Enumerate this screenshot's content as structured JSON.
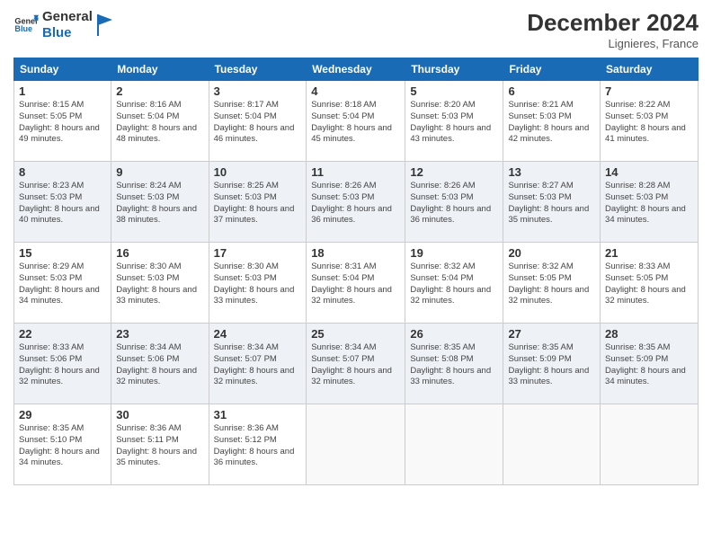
{
  "logo": {
    "line1": "General",
    "line2": "Blue"
  },
  "title": "December 2024",
  "location": "Lignieres, France",
  "days_of_week": [
    "Sunday",
    "Monday",
    "Tuesday",
    "Wednesday",
    "Thursday",
    "Friday",
    "Saturday"
  ],
  "weeks": [
    [
      {
        "day": "1",
        "sunrise": "8:15 AM",
        "sunset": "5:05 PM",
        "daylight": "8 hours and 49 minutes."
      },
      {
        "day": "2",
        "sunrise": "8:16 AM",
        "sunset": "5:04 PM",
        "daylight": "8 hours and 48 minutes."
      },
      {
        "day": "3",
        "sunrise": "8:17 AM",
        "sunset": "5:04 PM",
        "daylight": "8 hours and 46 minutes."
      },
      {
        "day": "4",
        "sunrise": "8:18 AM",
        "sunset": "5:04 PM",
        "daylight": "8 hours and 45 minutes."
      },
      {
        "day": "5",
        "sunrise": "8:20 AM",
        "sunset": "5:03 PM",
        "daylight": "8 hours and 43 minutes."
      },
      {
        "day": "6",
        "sunrise": "8:21 AM",
        "sunset": "5:03 PM",
        "daylight": "8 hours and 42 minutes."
      },
      {
        "day": "7",
        "sunrise": "8:22 AM",
        "sunset": "5:03 PM",
        "daylight": "8 hours and 41 minutes."
      }
    ],
    [
      {
        "day": "8",
        "sunrise": "8:23 AM",
        "sunset": "5:03 PM",
        "daylight": "8 hours and 40 minutes."
      },
      {
        "day": "9",
        "sunrise": "8:24 AM",
        "sunset": "5:03 PM",
        "daylight": "8 hours and 38 minutes."
      },
      {
        "day": "10",
        "sunrise": "8:25 AM",
        "sunset": "5:03 PM",
        "daylight": "8 hours and 37 minutes."
      },
      {
        "day": "11",
        "sunrise": "8:26 AM",
        "sunset": "5:03 PM",
        "daylight": "8 hours and 36 minutes."
      },
      {
        "day": "12",
        "sunrise": "8:26 AM",
        "sunset": "5:03 PM",
        "daylight": "8 hours and 36 minutes."
      },
      {
        "day": "13",
        "sunrise": "8:27 AM",
        "sunset": "5:03 PM",
        "daylight": "8 hours and 35 minutes."
      },
      {
        "day": "14",
        "sunrise": "8:28 AM",
        "sunset": "5:03 PM",
        "daylight": "8 hours and 34 minutes."
      }
    ],
    [
      {
        "day": "15",
        "sunrise": "8:29 AM",
        "sunset": "5:03 PM",
        "daylight": "8 hours and 34 minutes."
      },
      {
        "day": "16",
        "sunrise": "8:30 AM",
        "sunset": "5:03 PM",
        "daylight": "8 hours and 33 minutes."
      },
      {
        "day": "17",
        "sunrise": "8:30 AM",
        "sunset": "5:03 PM",
        "daylight": "8 hours and 33 minutes."
      },
      {
        "day": "18",
        "sunrise": "8:31 AM",
        "sunset": "5:04 PM",
        "daylight": "8 hours and 32 minutes."
      },
      {
        "day": "19",
        "sunrise": "8:32 AM",
        "sunset": "5:04 PM",
        "daylight": "8 hours and 32 minutes."
      },
      {
        "day": "20",
        "sunrise": "8:32 AM",
        "sunset": "5:05 PM",
        "daylight": "8 hours and 32 minutes."
      },
      {
        "day": "21",
        "sunrise": "8:33 AM",
        "sunset": "5:05 PM",
        "daylight": "8 hours and 32 minutes."
      }
    ],
    [
      {
        "day": "22",
        "sunrise": "8:33 AM",
        "sunset": "5:06 PM",
        "daylight": "8 hours and 32 minutes."
      },
      {
        "day": "23",
        "sunrise": "8:34 AM",
        "sunset": "5:06 PM",
        "daylight": "8 hours and 32 minutes."
      },
      {
        "day": "24",
        "sunrise": "8:34 AM",
        "sunset": "5:07 PM",
        "daylight": "8 hours and 32 minutes."
      },
      {
        "day": "25",
        "sunrise": "8:34 AM",
        "sunset": "5:07 PM",
        "daylight": "8 hours and 32 minutes."
      },
      {
        "day": "26",
        "sunrise": "8:35 AM",
        "sunset": "5:08 PM",
        "daylight": "8 hours and 33 minutes."
      },
      {
        "day": "27",
        "sunrise": "8:35 AM",
        "sunset": "5:09 PM",
        "daylight": "8 hours and 33 minutes."
      },
      {
        "day": "28",
        "sunrise": "8:35 AM",
        "sunset": "5:09 PM",
        "daylight": "8 hours and 34 minutes."
      }
    ],
    [
      {
        "day": "29",
        "sunrise": "8:35 AM",
        "sunset": "5:10 PM",
        "daylight": "8 hours and 34 minutes."
      },
      {
        "day": "30",
        "sunrise": "8:36 AM",
        "sunset": "5:11 PM",
        "daylight": "8 hours and 35 minutes."
      },
      {
        "day": "31",
        "sunrise": "8:36 AM",
        "sunset": "5:12 PM",
        "daylight": "8 hours and 36 minutes."
      },
      null,
      null,
      null,
      null
    ]
  ]
}
